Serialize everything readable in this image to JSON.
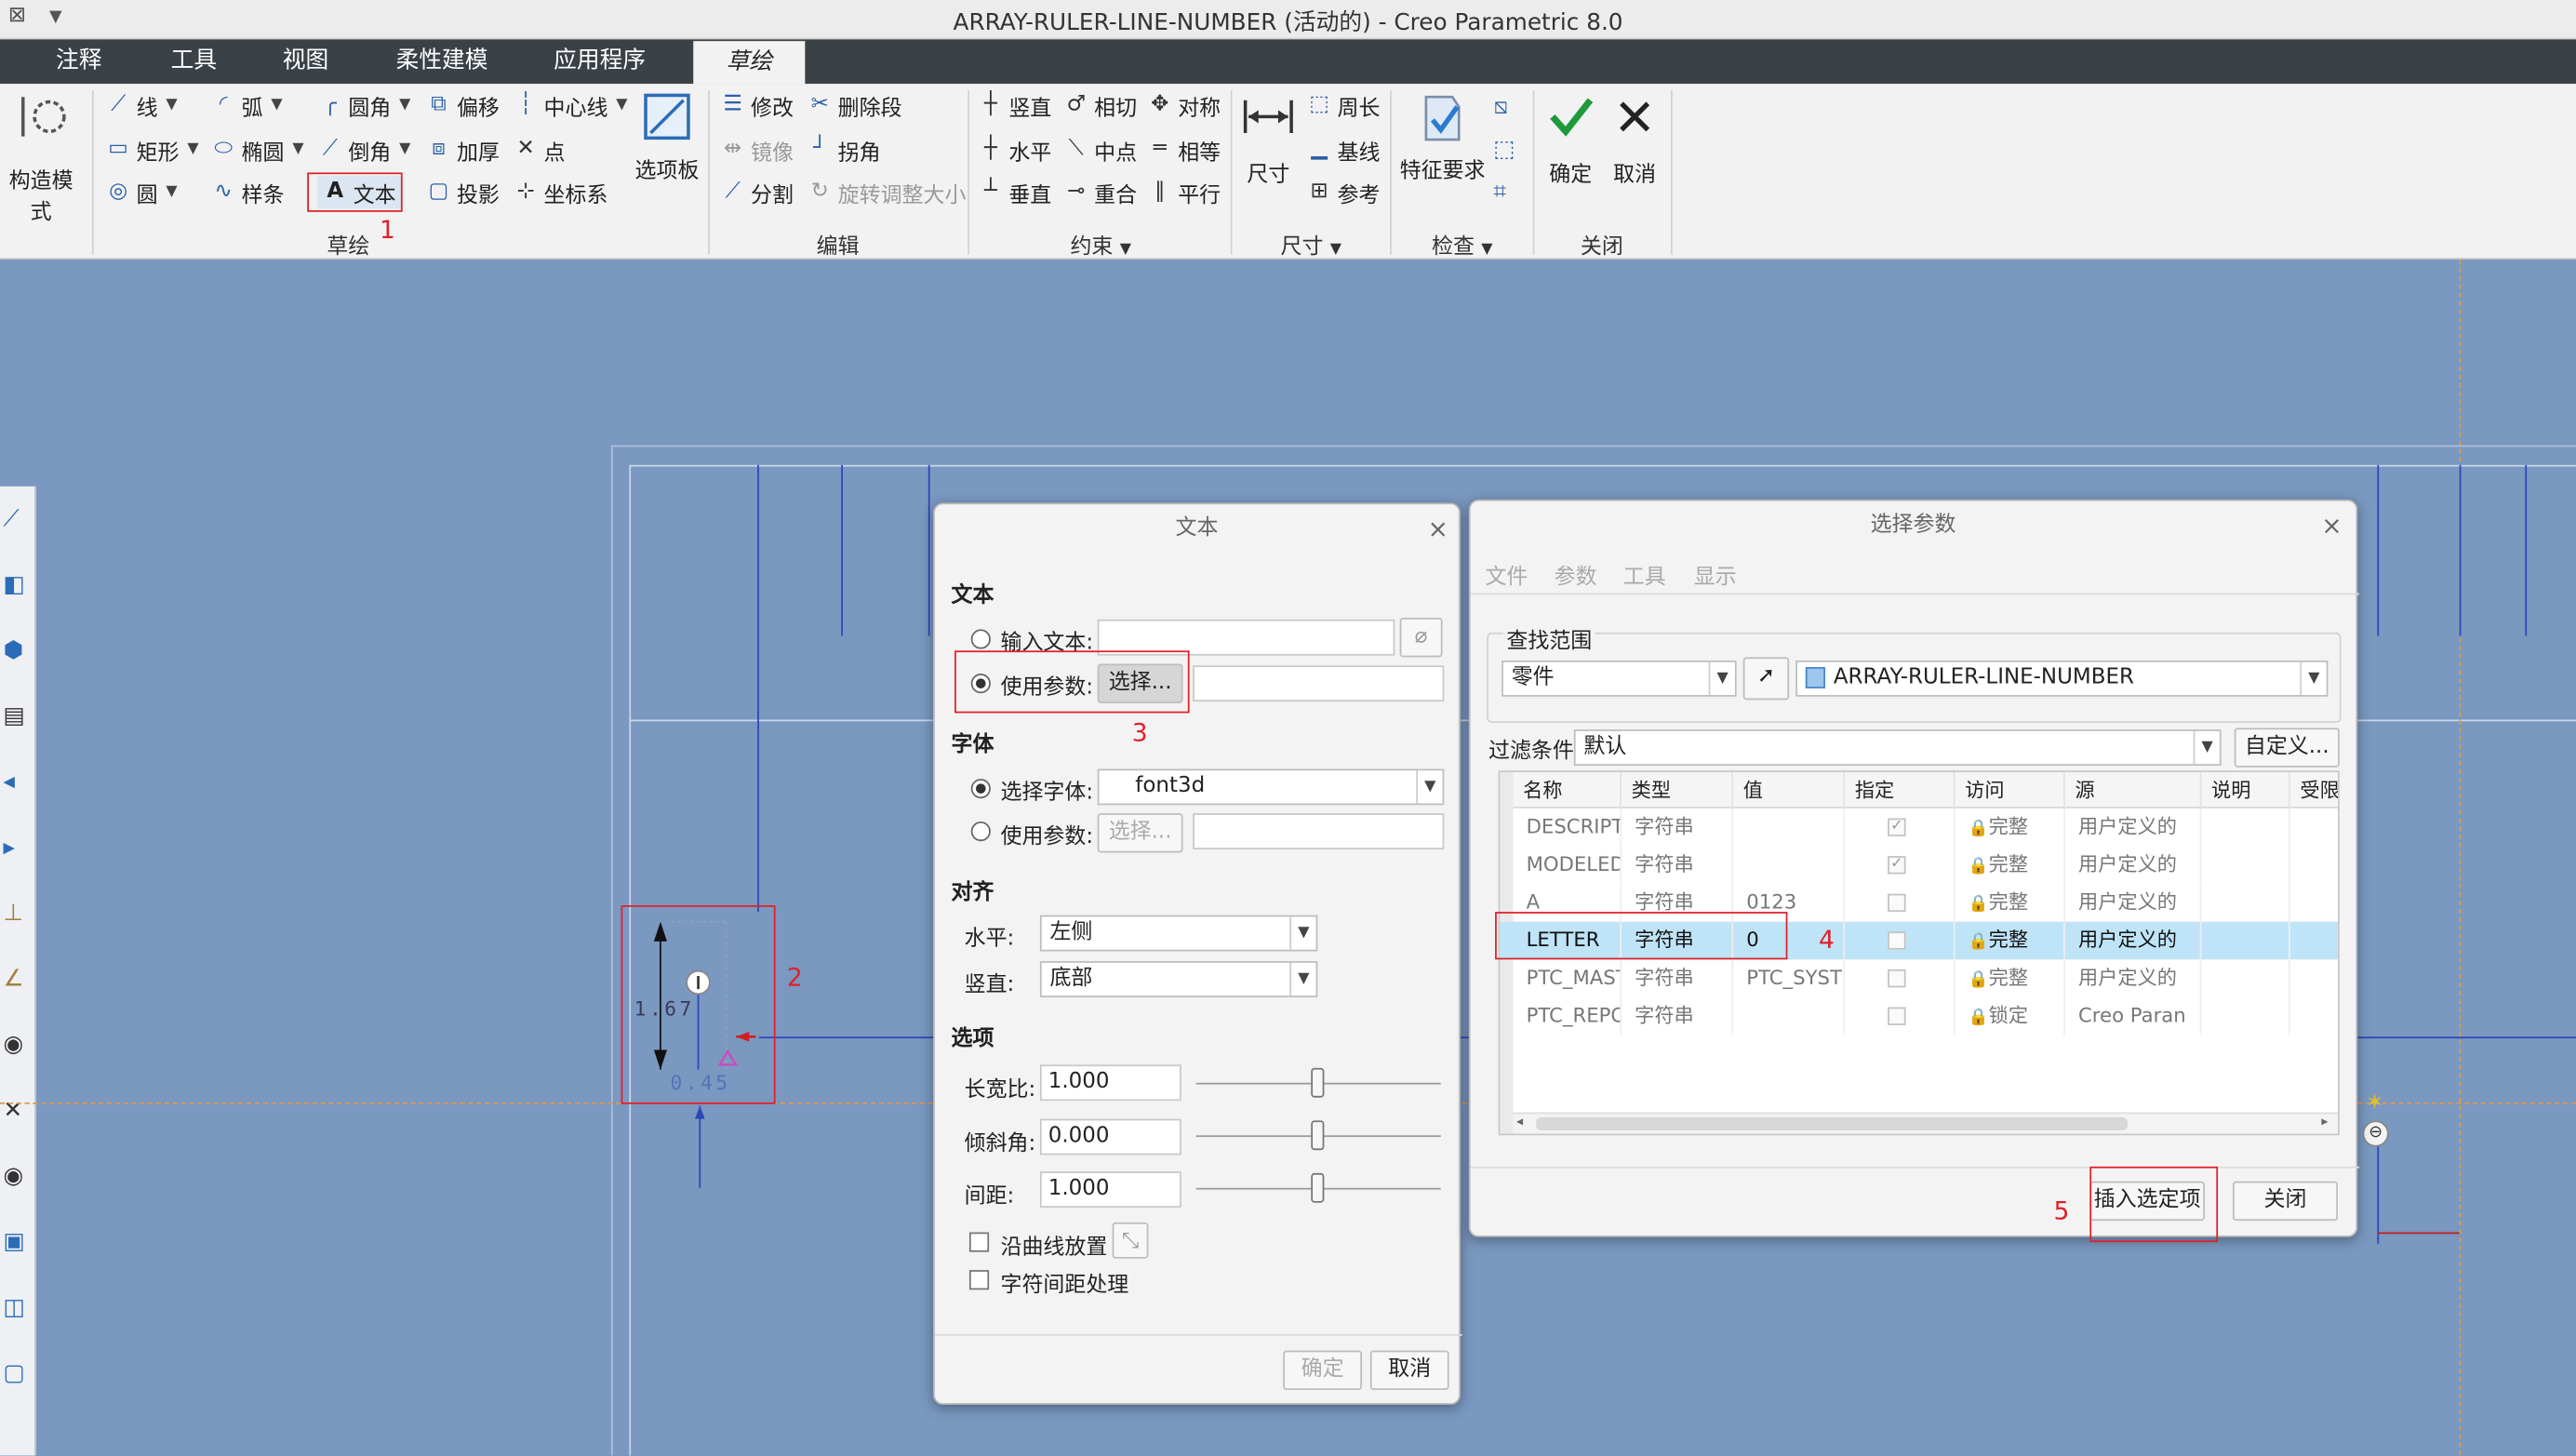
{
  "window": {
    "title": "ARRAY-RULER-LINE-NUMBER (活动的) - Creo Parametric 8.0"
  },
  "tabs": [
    "注释",
    "工具",
    "视图",
    "柔性建模",
    "应用程序",
    "草绘"
  ],
  "ribbon": {
    "construction_mode": "构造模式",
    "sketch": {
      "line": "线",
      "arc": "弧",
      "fillet": "圆角",
      "offset": "偏移",
      "centerline": "中心线",
      "rectangle": "矩形",
      "ellipse": "椭圆",
      "chamfer": "倒角",
      "thicken": "加厚",
      "point": "点",
      "circle": "圆",
      "spline": "样条",
      "text": "文本",
      "project": "投影",
      "csys": "坐标系",
      "palette": "选项板",
      "group": "草绘"
    },
    "edit": {
      "modify": "修改",
      "delete_segment": "删除段",
      "mirror": "镜像",
      "corner": "拐角",
      "divide": "分割",
      "rotate_resize": "旋转调整大小",
      "group": "编辑"
    },
    "constrain": {
      "vertical": "竖直",
      "tangent": "相切",
      "symmetric": "对称",
      "horizontal": "水平",
      "midpoint": "中点",
      "equal": "相等",
      "perpendicular": "垂直",
      "coincident": "重合",
      "parallel": "平行",
      "group": "约束"
    },
    "dimension": {
      "dimension": "尺寸",
      "perimeter": "周长",
      "baseline": "基线",
      "reference": "参考",
      "group": "尺寸"
    },
    "inspect": {
      "feature_requirements": "特征要求",
      "group": "检查"
    },
    "close": {
      "ok": "确定",
      "cancel": "取消",
      "group": "关闭"
    }
  },
  "annotations": [
    "1",
    "2",
    "3",
    "4",
    "5"
  ],
  "sketch_dims": {
    "height": "1.67",
    "offset": "0.45"
  },
  "text_dialog": {
    "title": "文本",
    "text_section": "文本",
    "input_text": "输入文本:",
    "use_param": "使用参数:",
    "select_btn": "选择...",
    "font_section": "字体",
    "select_font": "选择字体:",
    "font_value": "font3d",
    "use_param2": "使用参数:",
    "select_btn2": "选择...",
    "align_section": "对齐",
    "horizontal": "水平:",
    "horizontal_value": "左侧",
    "vertical": "竖直:",
    "vertical_value": "底部",
    "options_section": "选项",
    "aspect": "长宽比:",
    "aspect_value": "1.000",
    "slant": "倾斜角:",
    "slant_value": "0.000",
    "spacing": "间距:",
    "spacing_value": "1.000",
    "along_curve": "沿曲线放置",
    "kerning": "字符间距处理",
    "ok": "确定",
    "cancel": "取消"
  },
  "param_dialog": {
    "title": "选择参数",
    "menu": [
      "文件",
      "参数",
      "工具",
      "显示"
    ],
    "lookin": "查找范围",
    "scope": "零件",
    "model": "ARRAY-RULER-LINE-NUMBER",
    "filter_label": "过滤条件",
    "filter_value": "默认",
    "customize": "自定义...",
    "columns": [
      "名称",
      "类型",
      "值",
      "指定",
      "访问",
      "源",
      "说明",
      "受限"
    ],
    "rows": [
      {
        "name": "DESCRIPTI",
        "type": "字符串",
        "value": "",
        "designated": true,
        "access": "完整",
        "source": "用户定义的"
      },
      {
        "name": "MODELED_",
        "type": "字符串",
        "value": "",
        "designated": true,
        "access": "完整",
        "source": "用户定义的"
      },
      {
        "name": "A",
        "type": "字符串",
        "value": "0123",
        "designated": false,
        "access": "完整",
        "source": "用户定义的"
      },
      {
        "name": "LETTER",
        "type": "字符串",
        "value": "0",
        "designated": false,
        "access": "完整",
        "source": "用户定义的"
      },
      {
        "name": "PTC_MAST",
        "type": "字符串",
        "value": "PTC_SYSTE",
        "designated": false,
        "access": "完整",
        "source": "用户定义的"
      },
      {
        "name": "PTC_REPO",
        "type": "字符串",
        "value": "",
        "designated": false,
        "access": "锁定",
        "source": "Creo Paran"
      }
    ],
    "insert": "插入选定项",
    "close": "关闭"
  },
  "colors": {
    "canvas": "#7a98c0",
    "highlight": "#e0202a",
    "tabbar": "#3a4147",
    "selected_row": "#bfe4f7",
    "ok_green": "#1f9a3a"
  }
}
